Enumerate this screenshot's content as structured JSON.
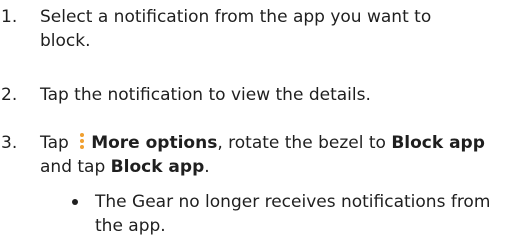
{
  "steps": [
    {
      "number": "1.",
      "lines": [
        "Select a notification from the app you want to",
        "block."
      ]
    },
    {
      "number": "2.",
      "text": "Tap the notification to view the details."
    },
    {
      "number": "3.",
      "pre": "Tap",
      "icon": "more-options-icon",
      "bold1": "More options",
      "mid": ", rotate the bezel to",
      "bold2": "Block app",
      "line2_pre": "and tap",
      "bold3": "Block app",
      "line2_post": "."
    }
  ],
  "bullet": {
    "lines": [
      "The Gear no longer receives notifications from",
      "the app."
    ]
  },
  "colors": {
    "text": "#1f1f1f",
    "icon_accent": "#f0a030"
  }
}
